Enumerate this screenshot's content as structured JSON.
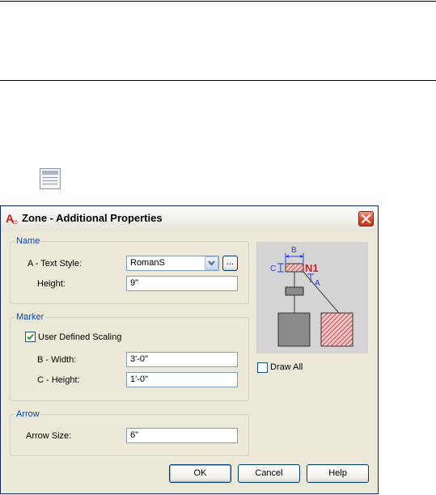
{
  "dialog": {
    "title": "Zone - Additional Properties",
    "app_icon_text": "A10"
  },
  "name_group": {
    "legend": "Name",
    "text_style_label": "A - Text Style:",
    "text_style_value": "RomanS",
    "browse_label": "...",
    "height_label": "Height:",
    "height_value": "9\""
  },
  "marker_group": {
    "legend": "Marker",
    "user_defined_scaling_label": "User Defined Scaling",
    "user_defined_scaling_checked": true,
    "width_label": "B - Width:",
    "width_value": "3'-0\"",
    "height_label": "C - Height:",
    "height_value": "1'-0\""
  },
  "arrow_group": {
    "legend": "Arrow",
    "arrow_size_label": "Arrow Size:",
    "arrow_size_value": "6\""
  },
  "preview": {
    "label_b": "B",
    "label_c": "C",
    "label_n1": "N1",
    "label_a": "A"
  },
  "draw_all": {
    "label": "Draw All",
    "checked": false
  },
  "buttons": {
    "ok": "OK",
    "cancel": "Cancel",
    "help": "Help"
  },
  "colors": {
    "legend_blue": "#0046d5",
    "dimension_blue": "#1e3cff",
    "marker_red": "#c8282d",
    "dialog_background": "#ece9d8"
  }
}
